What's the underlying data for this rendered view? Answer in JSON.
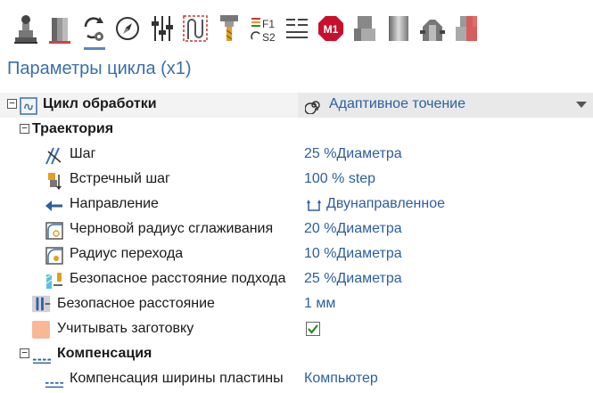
{
  "toolbar": {
    "tools": [
      {
        "name": "machine-setup-icon"
      },
      {
        "name": "stock-icon"
      },
      {
        "name": "cycle-parameters-icon",
        "active": true
      },
      {
        "name": "compass-icon"
      },
      {
        "name": "tuning-sliders-icon"
      },
      {
        "name": "toolpath-pattern-icon"
      },
      {
        "name": "tool-icon"
      },
      {
        "name": "feeds-speeds-icon",
        "f_label": "F1",
        "s_label": "S2"
      },
      {
        "name": "list-icon"
      },
      {
        "name": "m1-stop-icon",
        "label": "M1"
      },
      {
        "name": "part-view-icon"
      },
      {
        "name": "cylinder-icon"
      },
      {
        "name": "fixture-icon"
      },
      {
        "name": "section-icon"
      }
    ]
  },
  "panel": {
    "title": "Параметры цикла (x1)"
  },
  "rows": {
    "cycle": {
      "label": "Цикл обработки",
      "value": "Адаптивное точение"
    },
    "trajectory": {
      "label": "Траектория"
    },
    "step": {
      "label": "Шаг",
      "value": "25 %Диаметра"
    },
    "counter_step": {
      "label": "Встречный шаг",
      "value": "100 % step"
    },
    "direction": {
      "label": "Направление",
      "value": "Двунаправленное"
    },
    "rough_radius": {
      "label": "Черновой радиус сглаживания",
      "value": "20 %Диаметра"
    },
    "transition_radius": {
      "label": "Радиус перехода",
      "value": "10 %Диаметра"
    },
    "safe_approach": {
      "label": "Безопасное расстояние подхода",
      "value": "25 %Диаметра"
    },
    "safe_distance": {
      "label": "Безопасное расстояние",
      "value": "1 мм"
    },
    "consider_stock": {
      "label": "Учитывать заготовку",
      "checked": true
    },
    "compensation": {
      "label": "Компенсация"
    },
    "width_comp": {
      "label": "Компенсация ширины пластины",
      "value": "Компьютер"
    }
  },
  "colors": {
    "accent": "#2c5f9e",
    "title": "#3a6fa8",
    "check": "#2e8b2e"
  }
}
